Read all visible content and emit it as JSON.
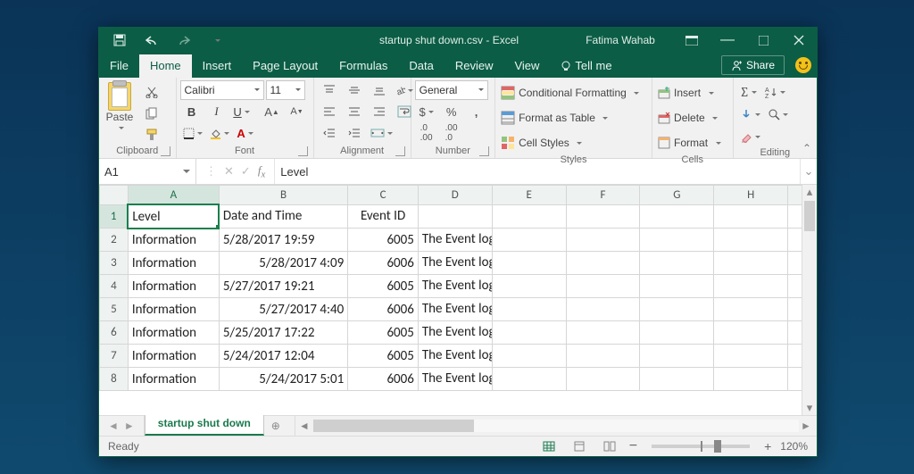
{
  "titlebar": {
    "filename": "startup shut down.csv",
    "sep": " - ",
    "app": "Excel",
    "user": "Fatima Wahab"
  },
  "tabs": {
    "file": "File",
    "home": "Home",
    "insert": "Insert",
    "page_layout": "Page Layout",
    "formulas": "Formulas",
    "data": "Data",
    "review": "Review",
    "view": "View",
    "tell_me": "Tell me",
    "share": "Share"
  },
  "ribbon": {
    "paste": "Paste",
    "clipboard": "Clipboard",
    "font_name": "Calibri",
    "font_size": "11",
    "font": "Font",
    "alignment": "Alignment",
    "number_format": "General",
    "number": "Number",
    "cond_fmt": "Conditional Formatting",
    "tbl_fmt": "Format as Table",
    "cell_styles": "Cell Styles",
    "styles": "Styles",
    "insert_btn": "Insert",
    "delete_btn": "Delete",
    "format_btn": "Format",
    "cells": "Cells",
    "editing": "Editing"
  },
  "formbar": {
    "name": "A1",
    "value": "Level"
  },
  "grid": {
    "cols": [
      "A",
      "B",
      "C",
      "D",
      "E",
      "F",
      "G",
      "H"
    ],
    "headers": {
      "A": "Level",
      "B": "Date and Time",
      "C": "Event ID"
    },
    "rows": [
      {
        "A": "Information",
        "B": "5/28/2017 19:59",
        "C": "6005",
        "D": "The Event log service was started."
      },
      {
        "A": "Information",
        "B": "5/28/2017 4:09",
        "C": "6006",
        "D": "The Event log service was stopped."
      },
      {
        "A": "Information",
        "B": "5/27/2017 19:21",
        "C": "6005",
        "D": "The Event log service was started."
      },
      {
        "A": "Information",
        "B": "5/27/2017 4:40",
        "C": "6006",
        "D": "The Event log service was stopped."
      },
      {
        "A": "Information",
        "B": "5/25/2017 17:22",
        "C": "6005",
        "D": "The Event log service was started."
      },
      {
        "A": "Information",
        "B": "5/24/2017 12:04",
        "C": "6005",
        "D": "The Event log service was started."
      },
      {
        "A": "Information",
        "B": "5/24/2017 5:01",
        "C": "6006",
        "D": "The Event log service was stopped."
      }
    ]
  },
  "sheetbar": {
    "tab": "startup shut down"
  },
  "statusbar": {
    "status": "Ready",
    "zoom": "120%"
  }
}
